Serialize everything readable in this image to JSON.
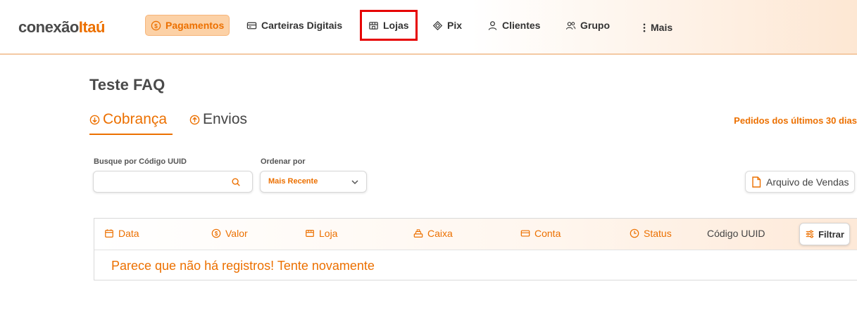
{
  "brand": {
    "part1": "conexão",
    "part2": "Itaú"
  },
  "nav": [
    {
      "label": "Pagamentos",
      "icon": "dollar-circle-icon"
    },
    {
      "label": "Carteiras Digitais",
      "icon": "card-icon"
    },
    {
      "label": "Lojas",
      "icon": "store-icon"
    },
    {
      "label": "Pix",
      "icon": "pix-icon"
    },
    {
      "label": "Clientes",
      "icon": "user-icon"
    },
    {
      "label": "Grupo",
      "icon": "users-icon"
    },
    {
      "label": "Mais",
      "icon": "vertical-dots-icon"
    }
  ],
  "page": {
    "title": "Teste FAQ"
  },
  "tabs": [
    {
      "label": "Cobrança",
      "icon": "arrow-down-circle-icon"
    },
    {
      "label": "Envios",
      "icon": "arrow-up-circle-icon"
    }
  ],
  "period_label": "Pedidos dos últimos 30 dias",
  "filters": {
    "search_label": "Busque por Código UUID",
    "search_value": "",
    "search_placeholder": "",
    "sort_label": "Ordenar por",
    "sort_value": "Mais Recente"
  },
  "export_label": "Arquivo de Vendas",
  "table": {
    "columns": [
      {
        "label": "Data",
        "icon": "calendar-icon"
      },
      {
        "label": "Valor",
        "icon": "dollar-circle-icon"
      },
      {
        "label": "Loja",
        "icon": "store-icon"
      },
      {
        "label": "Caixa",
        "icon": "cash-register-icon"
      },
      {
        "label": "Conta",
        "icon": "card-icon"
      },
      {
        "label": "Status",
        "icon": "clock-icon"
      },
      {
        "label": "Código UUID",
        "icon": ""
      }
    ],
    "filter_label": "Filtrar",
    "empty_message": "Parece que não há registros! Tente novamente"
  },
  "colors": {
    "accent": "#ec7000",
    "highlight": "#e60000",
    "active_nav_bg": "#fcd1a6"
  }
}
